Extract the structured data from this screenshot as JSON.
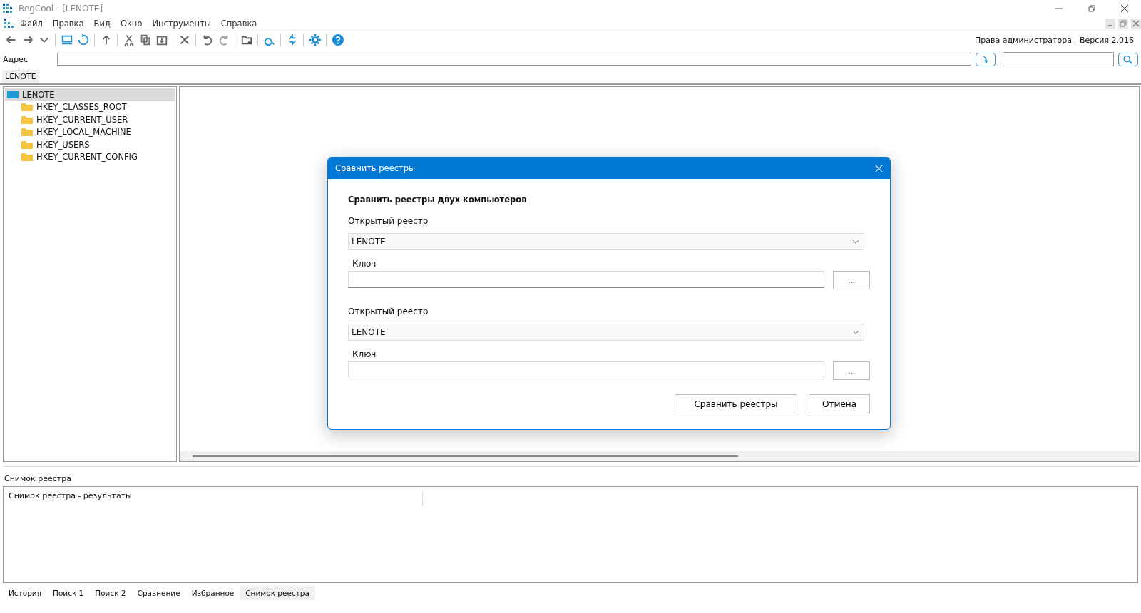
{
  "window": {
    "title": "RegCool - [LENOTE]"
  },
  "menu": [
    "Файл",
    "Правка",
    "Вид",
    "Окно",
    "Инструменты",
    "Справка"
  ],
  "status_right": "Права администратора - Версия 2.016",
  "address": {
    "label": "Адрес"
  },
  "breadcrumb": "LENOTE",
  "tree": {
    "label": "LENOTE",
    "selected": true,
    "children": [
      {
        "label": "HKEY_CLASSES_ROOT",
        "selected": false
      },
      {
        "label": "HKEY_CURRENT_USER",
        "selected": false
      },
      {
        "label": "HKEY_LOCAL_MACHINE",
        "selected": false
      },
      {
        "label": "HKEY_USERS",
        "selected": false
      },
      {
        "label": "HKEY_CURRENT_CONFIG",
        "selected": false
      }
    ]
  },
  "dialog": {
    "title": "Сравнить реестры",
    "heading": "Сравнить реестры двух компьютеров",
    "sections": [
      {
        "registry_label": "Открытый реестр",
        "registry_value": "LENOTE",
        "key_label": "Ключ",
        "browse": "..."
      },
      {
        "registry_label": "Открытый реестр",
        "registry_value": "LENOTE",
        "key_label": "Ключ",
        "browse": "..."
      }
    ],
    "buttons": [
      "Сравнить реестры",
      "Отмена"
    ]
  },
  "bottom_panel": {
    "title": "Снимок реестра",
    "results_header": "Снимок реестра - результаты"
  },
  "tabs": [
    {
      "label": "История",
      "selected": false
    },
    {
      "label": "Поиск 1",
      "selected": false
    },
    {
      "label": "Поиск 2",
      "selected": false
    },
    {
      "label": "Сравнение",
      "selected": false
    },
    {
      "label": "Избранное",
      "selected": false
    },
    {
      "label": "Снимок реестра",
      "selected": true
    }
  ]
}
